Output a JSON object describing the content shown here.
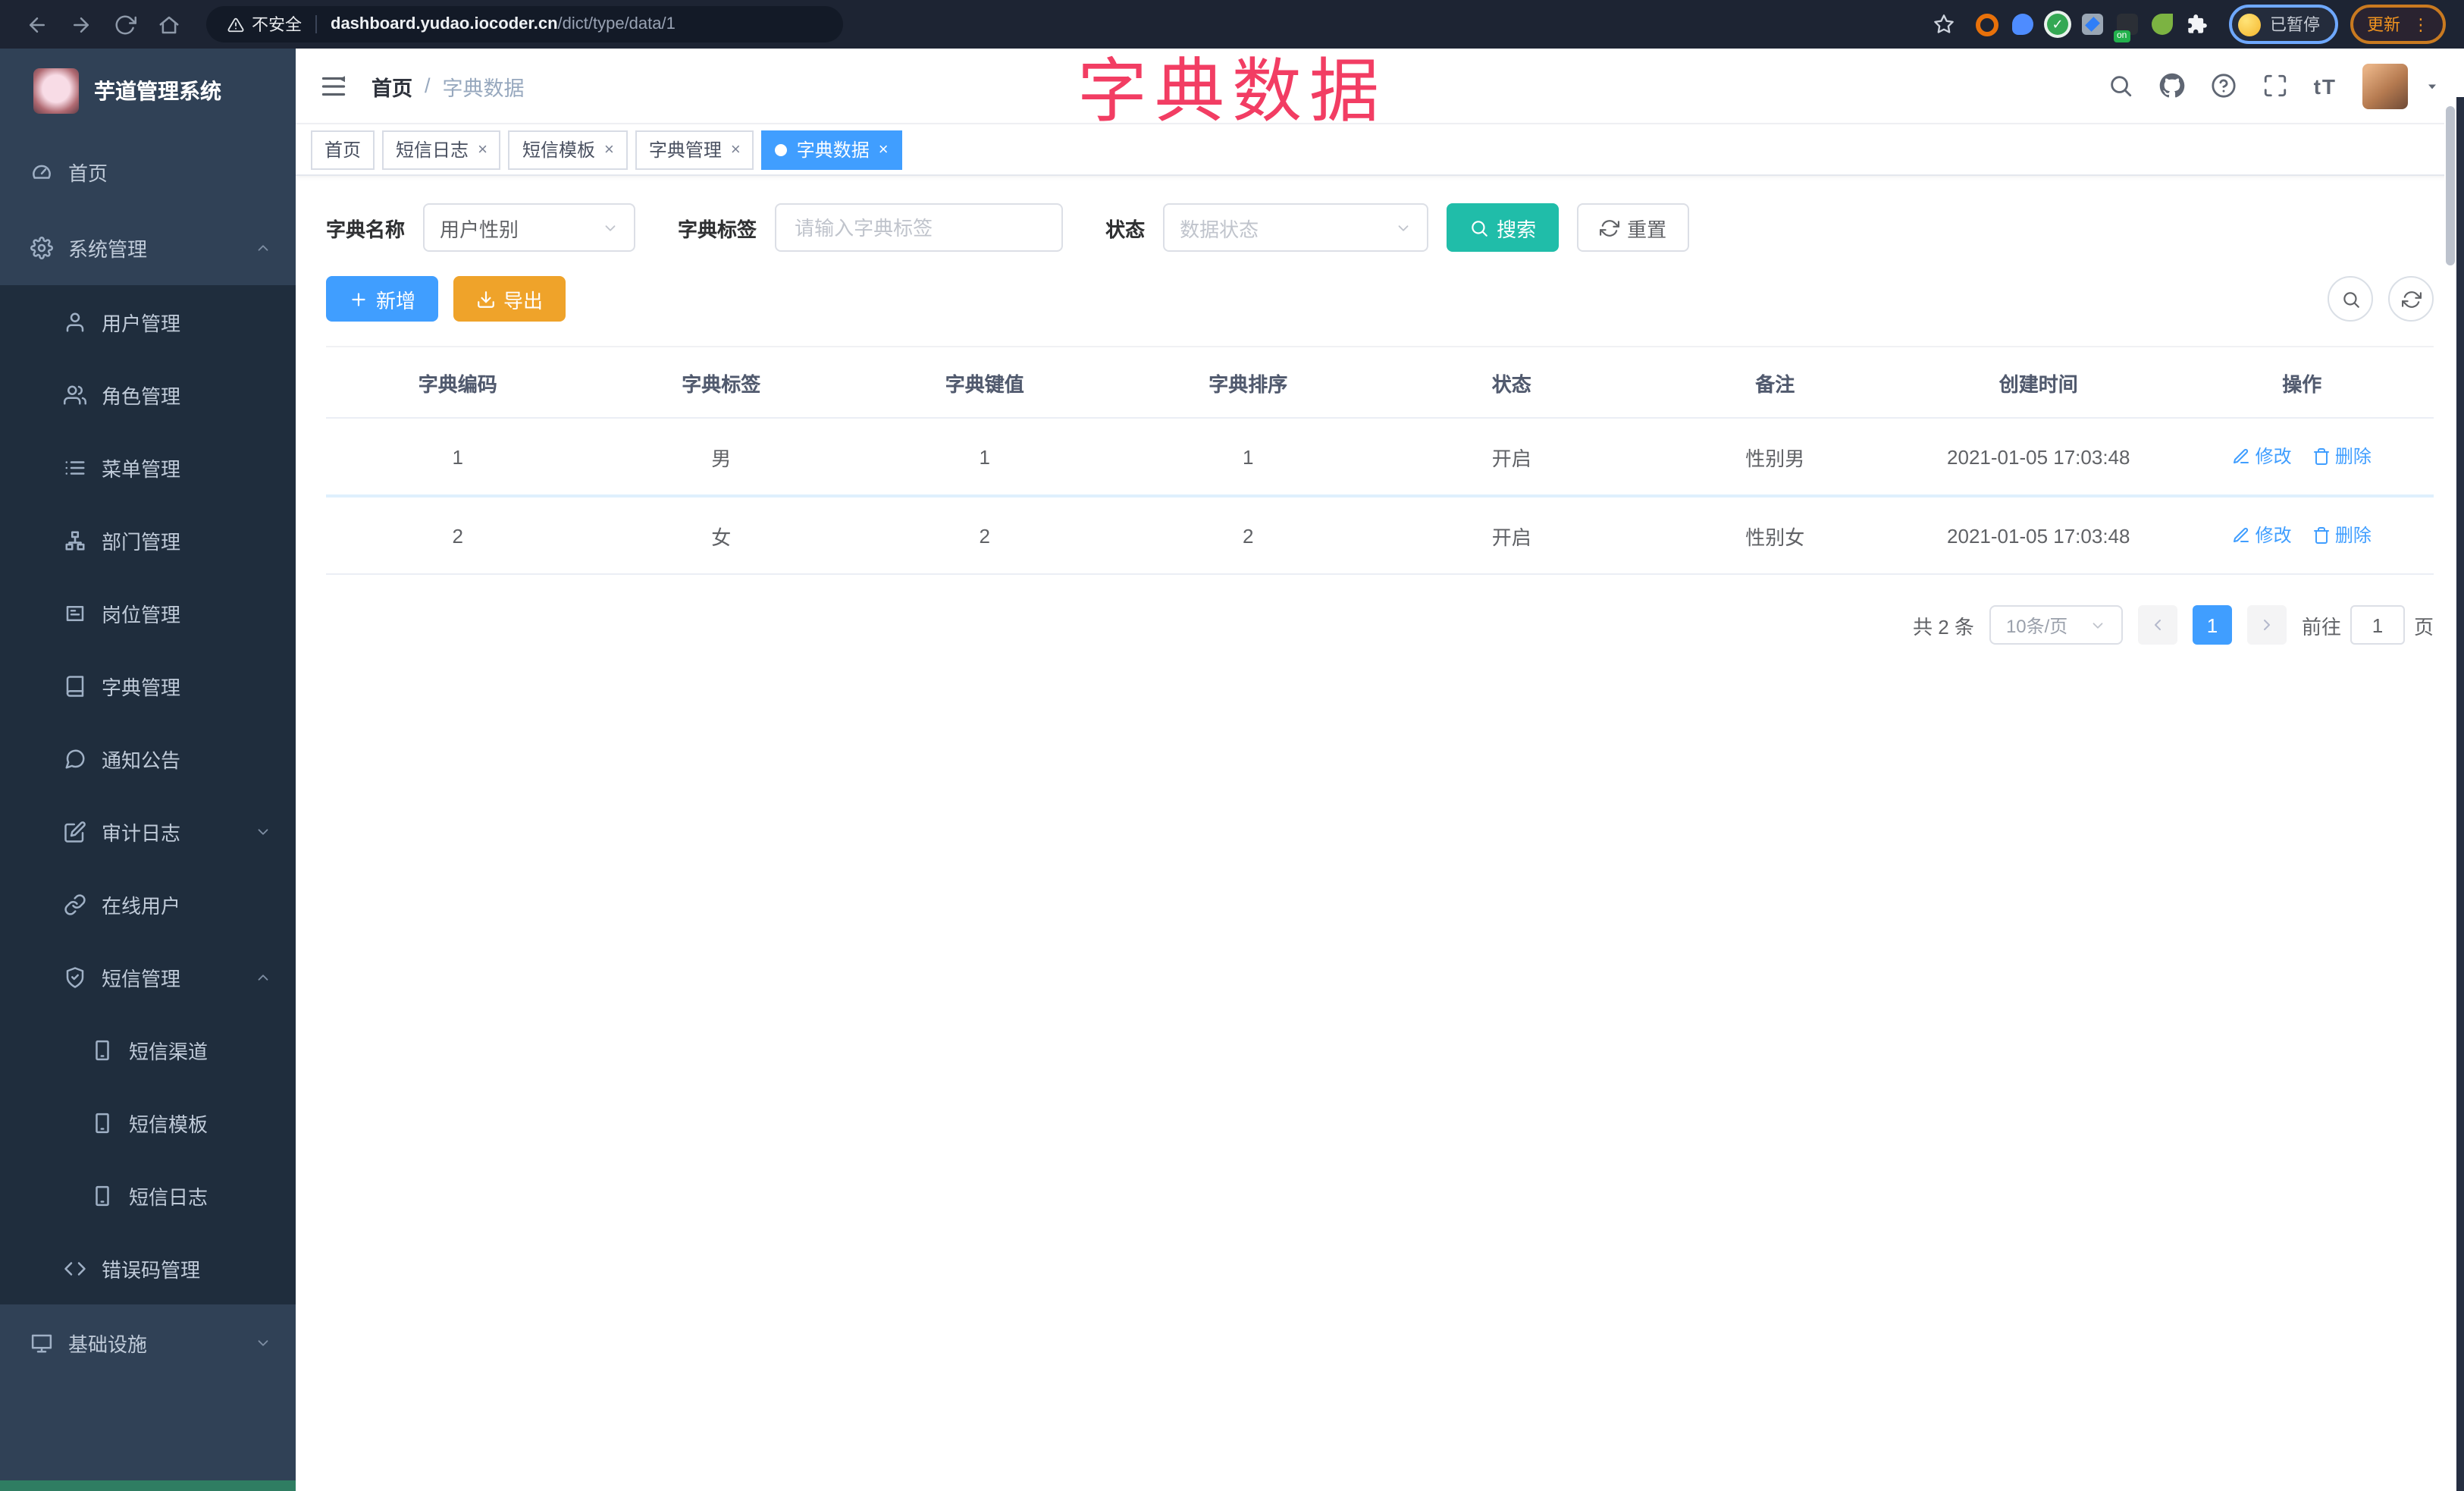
{
  "browser": {
    "insecure_label": "不安全",
    "url_host": "dashboard.yudao.iocoder.cn",
    "url_path": "/dict/type/data/1",
    "on_badge": "on",
    "paused_label": "已暂停",
    "update_label": "更新",
    "kebab": "⋮"
  },
  "watermark": "字典数据",
  "sidebar": {
    "logo_title": "芋道管理系统",
    "items": [
      {
        "label": "首页",
        "icon": "dashboard"
      },
      {
        "label": "系统管理",
        "icon": "gear"
      },
      {
        "label": "用户管理",
        "icon": "user"
      },
      {
        "label": "角色管理",
        "icon": "users"
      },
      {
        "label": "菜单管理",
        "icon": "menu-list"
      },
      {
        "label": "部门管理",
        "icon": "org-tree"
      },
      {
        "label": "岗位管理",
        "icon": "id-badge"
      },
      {
        "label": "字典管理",
        "icon": "book"
      },
      {
        "label": "通知公告",
        "icon": "message"
      },
      {
        "label": "审计日志",
        "icon": "edit-log"
      },
      {
        "label": "在线用户",
        "icon": "link"
      },
      {
        "label": "短信管理",
        "icon": "shield-check"
      },
      {
        "label": "短信渠道",
        "icon": "phone"
      },
      {
        "label": "短信模板",
        "icon": "phone"
      },
      {
        "label": "短信日志",
        "icon": "phone"
      },
      {
        "label": "错误码管理",
        "icon": "code"
      },
      {
        "label": "基础设施",
        "icon": "monitor"
      }
    ]
  },
  "navbar": {
    "breadcrumb_first": "首页",
    "breadcrumb_sep": "/",
    "breadcrumb_last": "字典数据",
    "font_size_label": "tT"
  },
  "tabs": [
    {
      "label": "首页"
    },
    {
      "label": "短信日志"
    },
    {
      "label": "短信模板"
    },
    {
      "label": "字典管理"
    },
    {
      "label": "字典数据"
    }
  ],
  "filters": {
    "name_label": "字典名称",
    "name_value": "用户性别",
    "tag_label": "字典标签",
    "tag_placeholder": "请输入字典标签",
    "status_label": "状态",
    "status_placeholder": "数据状态",
    "search_label": "搜索",
    "reset_label": "重置"
  },
  "toolbar": {
    "add_label": "新增",
    "export_label": "导出"
  },
  "table": {
    "headers": [
      "字典编码",
      "字典标签",
      "字典键值",
      "字典排序",
      "状态",
      "备注",
      "创建时间",
      "操作"
    ],
    "rows": [
      {
        "cells": [
          "1",
          "男",
          "1",
          "1",
          "开启",
          "性别男",
          "2021-01-05 17:03:48"
        ]
      },
      {
        "cells": [
          "2",
          "女",
          "2",
          "2",
          "开启",
          "性别女",
          "2021-01-05 17:03:48"
        ]
      }
    ],
    "edit_label": "修改",
    "delete_label": "删除"
  },
  "pagination": {
    "total_label": "共 2 条",
    "page_size": "10条/页",
    "current_page": "1",
    "goto_label": "前往",
    "goto_value": "1",
    "page_unit": "页"
  },
  "colors": {
    "accent_blue": "#409EFF",
    "search_teal": "#20bda9",
    "export_orange": "#efa32a",
    "watermark_pink": "#f23d63",
    "sidebar_bg": "#304156",
    "submenu_bg": "#1f2d3d"
  }
}
